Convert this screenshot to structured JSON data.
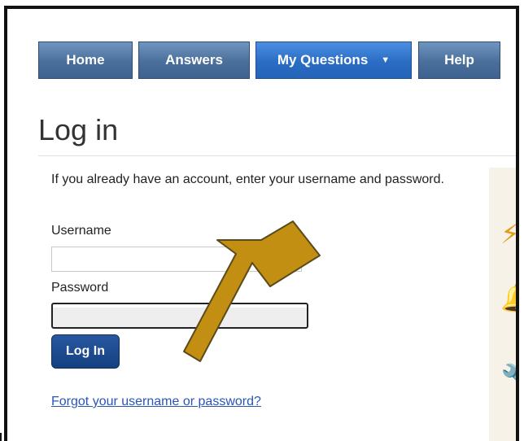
{
  "nav": {
    "home": "Home",
    "answers": "Answers",
    "my_questions": "My Questions",
    "help": "Help"
  },
  "page": {
    "title": "Log in",
    "intro": "If you already have an account, enter your username and password."
  },
  "form": {
    "username_label": "Username",
    "username_value": "",
    "password_label": "Password",
    "password_value": "",
    "submit_label": "Log In",
    "forgot_link": "Forgot your username or password?"
  },
  "sidebar": {
    "icons": [
      "lightning-icon",
      "bell-icon",
      "wrench-icon"
    ]
  },
  "colors": {
    "nav_button": "#4a6f9b",
    "nav_active": "#2a6dc4",
    "login_button": "#13407f",
    "link": "#2a55b8",
    "annotation_arrow": "#c28f12"
  }
}
